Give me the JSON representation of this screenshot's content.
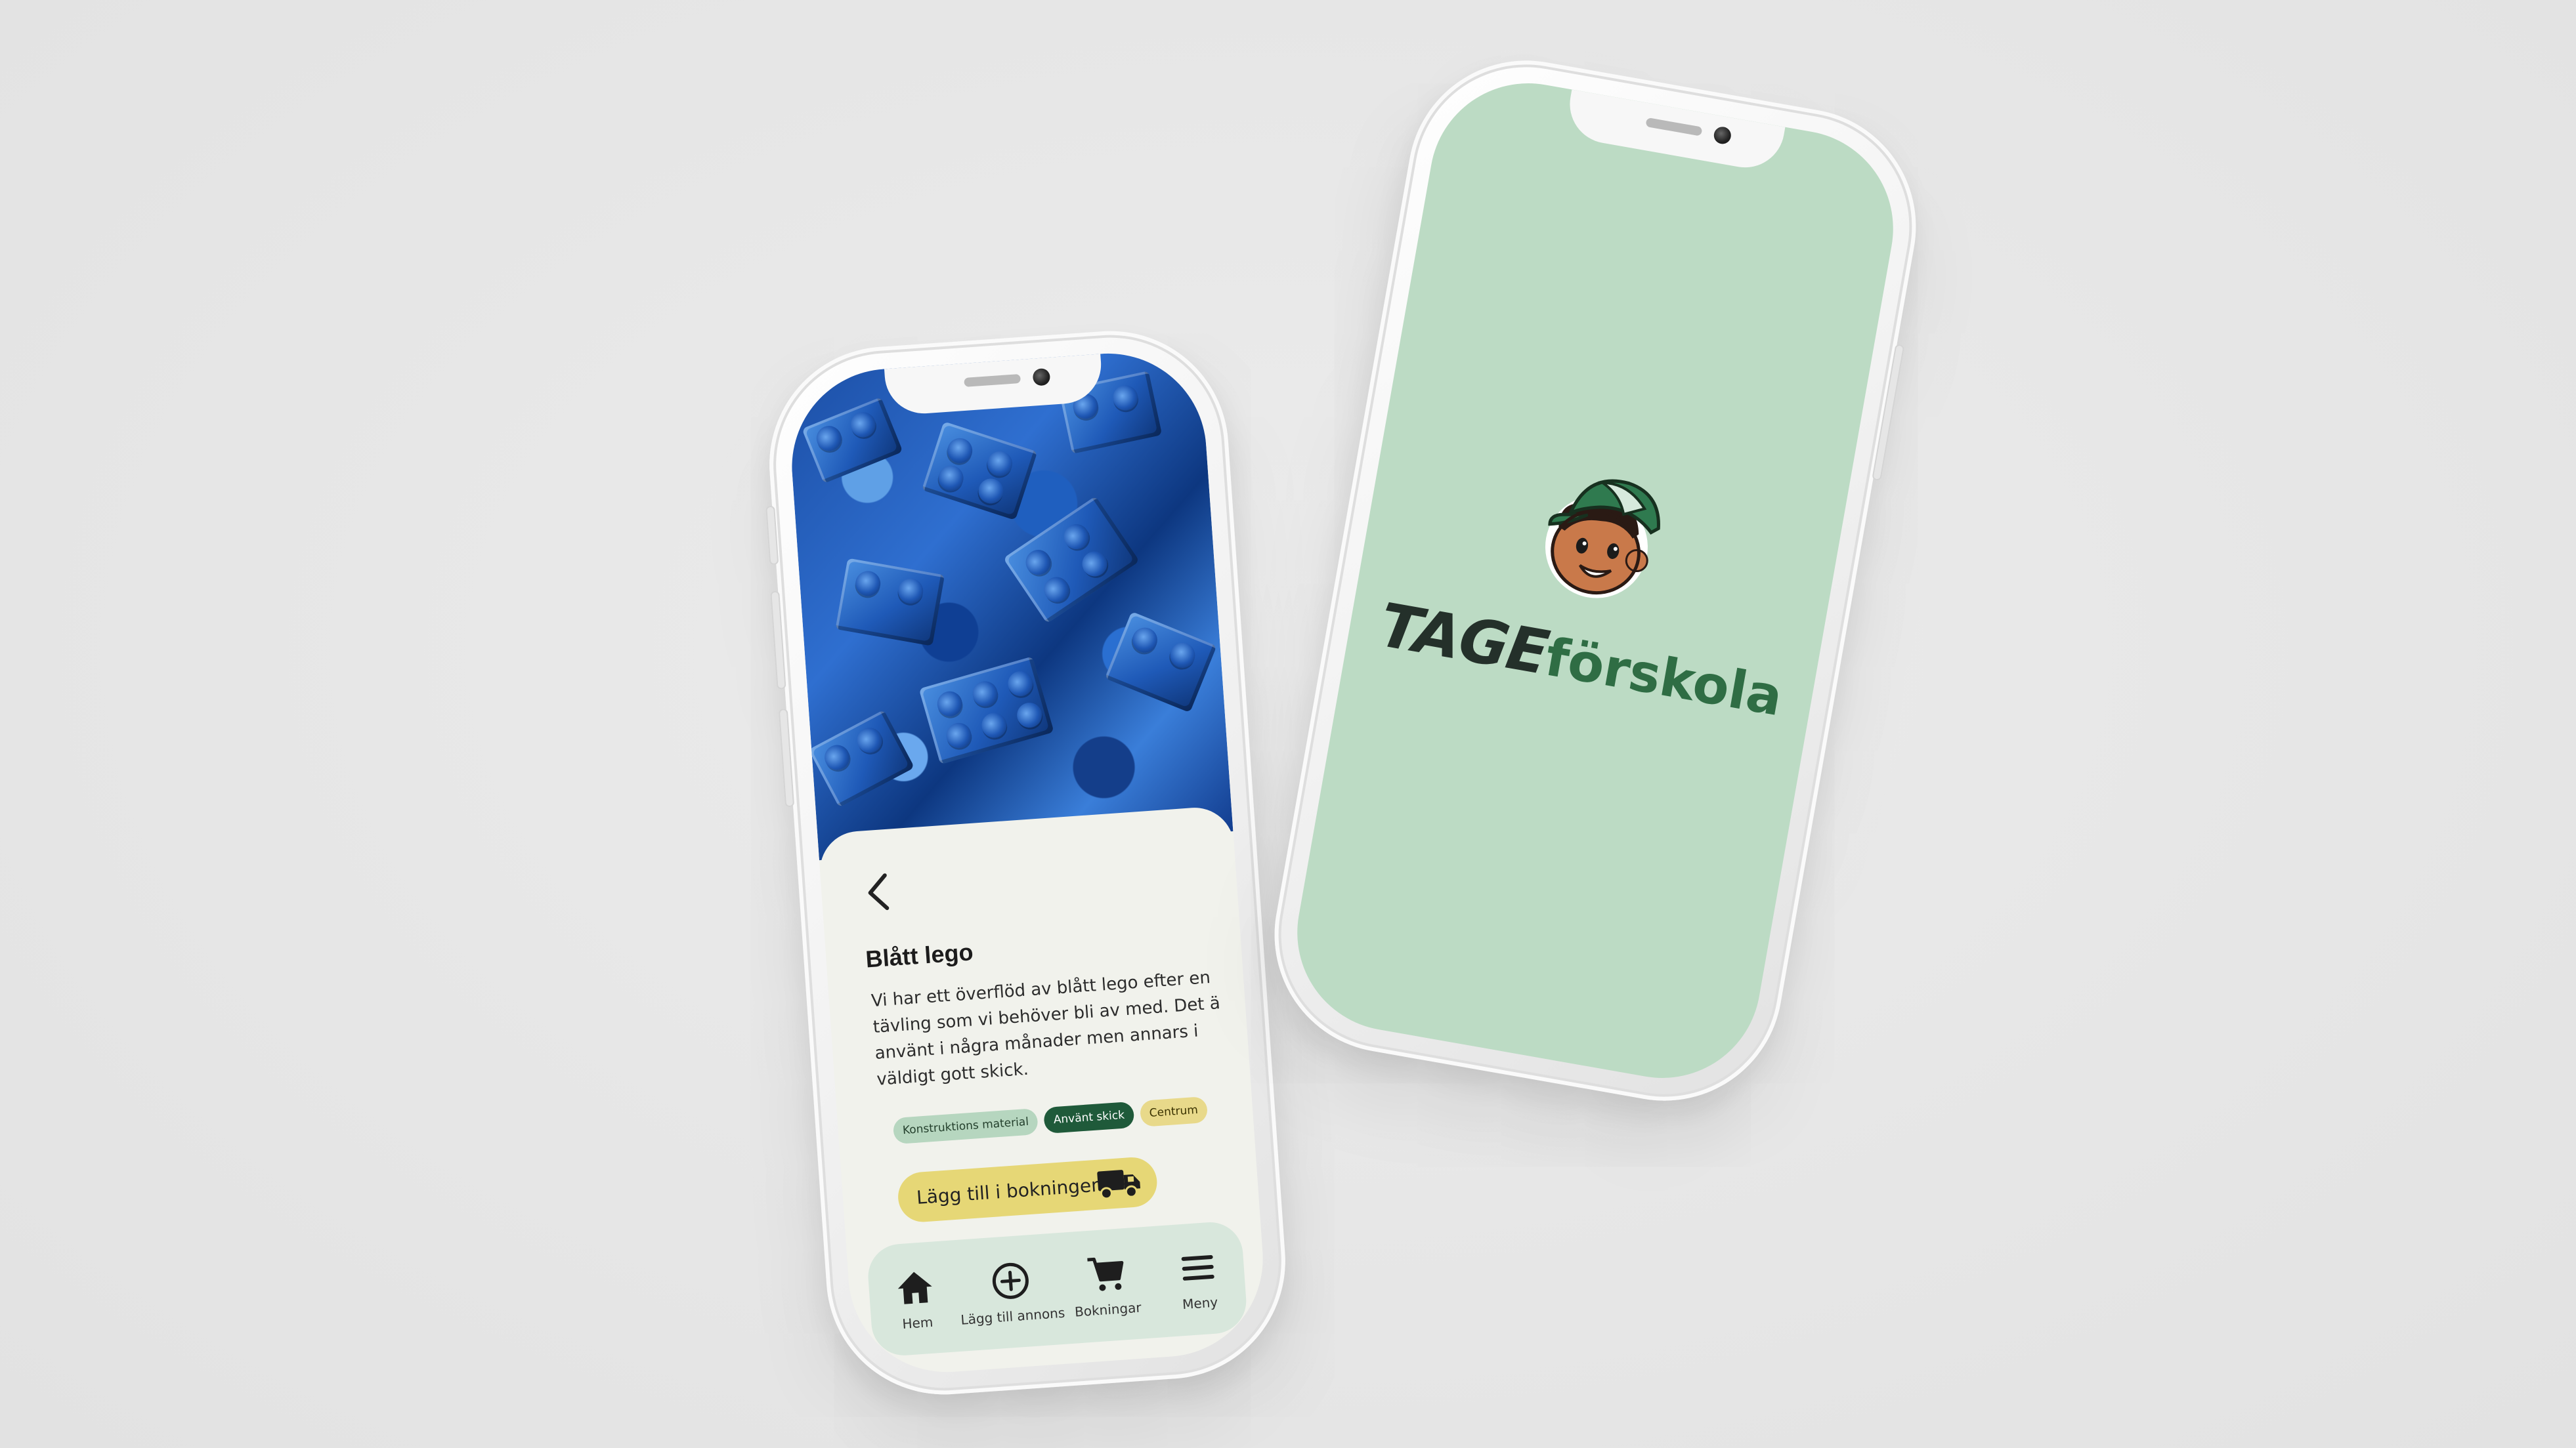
{
  "splash": {
    "brand_strong": "TAGE",
    "brand_light": "förskola",
    "background": "#bcdbc4"
  },
  "detail": {
    "title": "Blått lego",
    "description": "Vi har ett överflöd av blått lego efter en tävling som vi behöver bli av med. Det ä använt i några månader men annars i väldigt gott skick.",
    "tags": [
      {
        "label": "Konstruktions material",
        "color": "#b6d6bf"
      },
      {
        "label": "Använt skick",
        "color": "#1f5a3a"
      },
      {
        "label": "Centrum",
        "color": "#e8d98a"
      }
    ],
    "book_button_label": "Lägg till i bokningen",
    "back_icon": "chevron-left-icon",
    "accent": "#e6d776"
  },
  "nav": {
    "items": [
      {
        "label": "Hem",
        "icon": "home-icon"
      },
      {
        "label": "Lägg till annons",
        "icon": "plus-circle-icon"
      },
      {
        "label": "Bokningar",
        "icon": "cart-icon"
      },
      {
        "label": "Meny",
        "icon": "menu-icon"
      }
    ]
  }
}
